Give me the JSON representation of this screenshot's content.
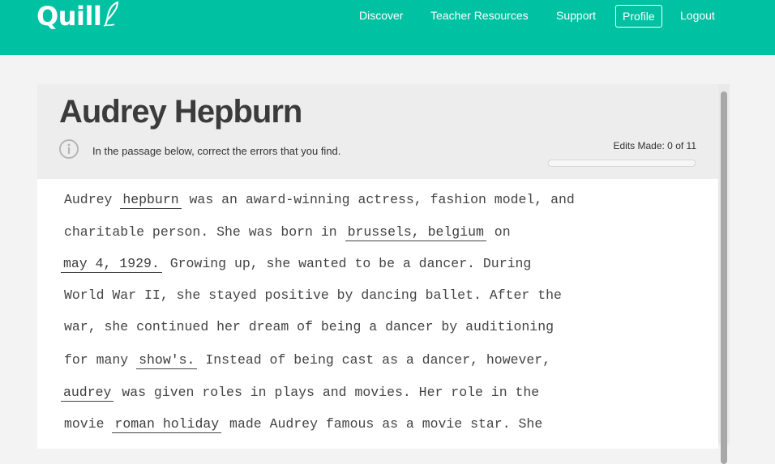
{
  "brand": {
    "name": "Quill",
    "color": "#00c2a2"
  },
  "nav": {
    "items": [
      {
        "label": "Discover"
      },
      {
        "label": "Teacher Resources"
      },
      {
        "label": "Support"
      },
      {
        "label": "Profile"
      },
      {
        "label": "Logout"
      }
    ]
  },
  "activity": {
    "title": "Audrey Hepburn",
    "instructions": "In the passage below, correct the errors that you find.",
    "edits_label": "Edits Made: 0 of 11",
    "edits_made": 0,
    "edits_total": 11
  },
  "passage": {
    "lines": [
      {
        "before": "Audrey ",
        "edit": "hepburn",
        "after": " was an award-winning actress, fashion model, and"
      },
      {
        "before": "charitable person. She was born in ",
        "edit": "brussels, belgium",
        "after": " on"
      },
      {
        "before": "",
        "edit": "may 4, 1929.",
        "after": " Growing up, she wanted to be a dancer. During"
      },
      {
        "before": "World War II, she stayed positive by dancing ballet. After the",
        "edit": "",
        "after": ""
      },
      {
        "before": "war, she continued her dream of being a dancer by auditioning",
        "edit": "",
        "after": ""
      },
      {
        "before": "for many ",
        "edit": "show's.",
        "after": " Instead of being cast as a dancer, however,"
      },
      {
        "before": "",
        "edit": "audrey",
        "after": " was given roles in plays and movies. Her role in the"
      },
      {
        "before": "movie ",
        "edit": "roman holiday",
        "after": " made Audrey famous as a movie star. She"
      }
    ]
  }
}
